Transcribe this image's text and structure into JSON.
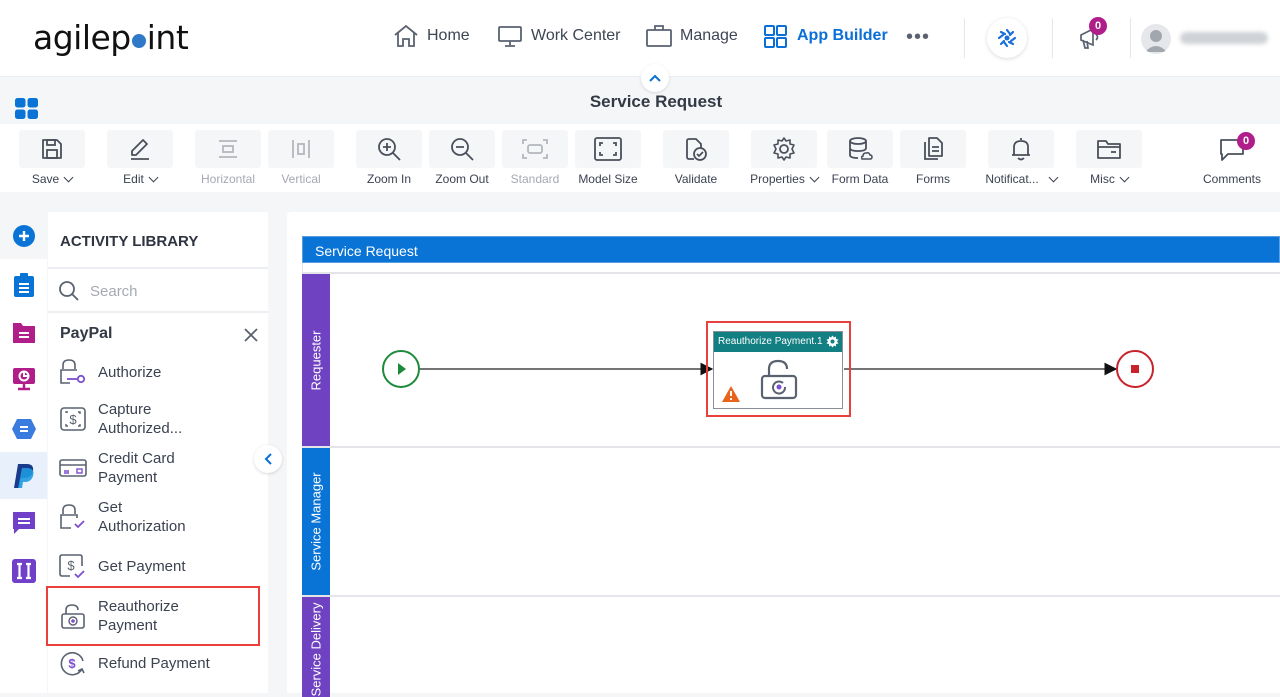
{
  "header": {
    "logo": {
      "pre": "agilep",
      "post": "int"
    },
    "nav": [
      {
        "label": "Home",
        "icon": "home-icon"
      },
      {
        "label": "Work Center",
        "icon": "monitor-icon"
      },
      {
        "label": "Manage",
        "icon": "briefcase-icon"
      },
      {
        "label": "App Builder",
        "icon": "grid-icon",
        "active": true
      }
    ],
    "more_label": "•••",
    "notifications_count": "0",
    "accent": "#0a6fd6",
    "badge_color": "#b01e8a"
  },
  "page": {
    "title": "Service Request"
  },
  "toolbar": {
    "buttons": [
      {
        "label": "Save",
        "dropdown": true
      },
      {
        "label": "Edit",
        "dropdown": true
      },
      {
        "label": "Horizontal",
        "disabled": true
      },
      {
        "label": "Vertical",
        "disabled": true
      },
      {
        "label": "Zoom In"
      },
      {
        "label": "Zoom Out"
      },
      {
        "label": "Standard",
        "disabled": true
      },
      {
        "label": "Model Size"
      },
      {
        "label": "Validate"
      },
      {
        "label": "Properties",
        "dropdown": true
      },
      {
        "label": "Form Data"
      },
      {
        "label": "Forms"
      },
      {
        "label": "Notificat...",
        "dropdown": true
      },
      {
        "label": "Misc",
        "dropdown": true
      },
      {
        "label": "Comments",
        "badge": "0"
      }
    ]
  },
  "rail": {
    "items": [
      "add-icon",
      "clipboard-icon",
      "folder-icon",
      "monitor-chart-icon",
      "hexagon-icon",
      "paypal-icon",
      "chat-icon",
      "ii-icon"
    ]
  },
  "library": {
    "title": "ACTIVITY LIBRARY",
    "search_placeholder": "Search",
    "category": "PayPal",
    "activities": [
      {
        "line1": "Authorize",
        "line2": ""
      },
      {
        "line1": "Capture",
        "line2": "Authorized..."
      },
      {
        "line1": "Credit Card",
        "line2": "Payment"
      },
      {
        "line1": "Get",
        "line2": "Authorization"
      },
      {
        "line1": "Get Payment",
        "line2": ""
      },
      {
        "line1": "Reauthorize",
        "line2": "Payment",
        "highlighted": true
      },
      {
        "line1": "Refund Payment",
        "line2": ""
      }
    ]
  },
  "process": {
    "pool": "Service Request",
    "lanes": [
      {
        "label": "Requester",
        "color": "#6f42c1"
      },
      {
        "label": "Service Manager",
        "color": "#0a74d6"
      },
      {
        "label": "Service Delivery",
        "color": "#6f42c1"
      }
    ],
    "task": {
      "title": "Reauthorize Payment.1",
      "warning": true,
      "header_color": "#127f82"
    }
  }
}
